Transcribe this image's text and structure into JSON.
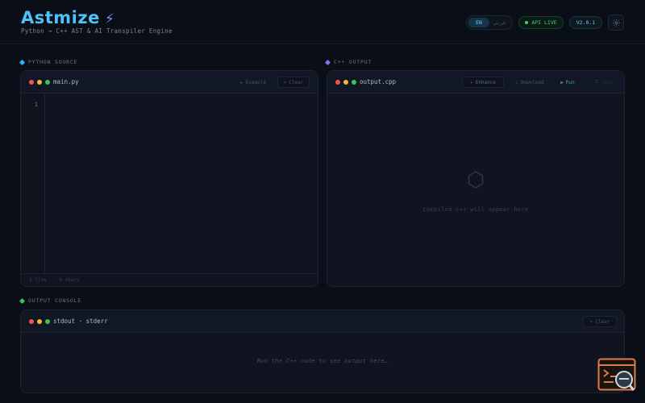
{
  "header": {
    "brand": "Astmize",
    "brand_icon": "bolt-icon",
    "tagline": "Python → C++ AST & AI Transpiler Engine",
    "lang_en": "EN",
    "lang_ar": "عربي",
    "api_status": "API LIVE",
    "version": "V2.0.1",
    "settings_icon": "gear-icon"
  },
  "python_panel": {
    "section_label": "PYTHON SOURCE",
    "file_name": "main.py",
    "example_label": "Example",
    "clear_label": "Clear",
    "line_number": "1",
    "status_lines": "1 line",
    "status_chars": "0 chars"
  },
  "cpp_panel": {
    "section_label": "C++ OUTPUT",
    "file_name": "output.cpp",
    "enhance_label": "Enhance",
    "download_label": "Download",
    "run_label": "Run",
    "copy_label": "Copy",
    "placeholder": "Compiled C++ will appear here"
  },
  "console_panel": {
    "section_label": "OUTPUT CONSOLE",
    "title": "stdout · stderr",
    "clear_label": "Clear",
    "placeholder": "Run the C++ code to see output here…"
  },
  "colors": {
    "accent": "#4fc3f7",
    "python_marker": "#29b6f6",
    "cpp_marker": "#8e6cf5",
    "console_marker": "#3fc356",
    "live": "#44d07a"
  }
}
